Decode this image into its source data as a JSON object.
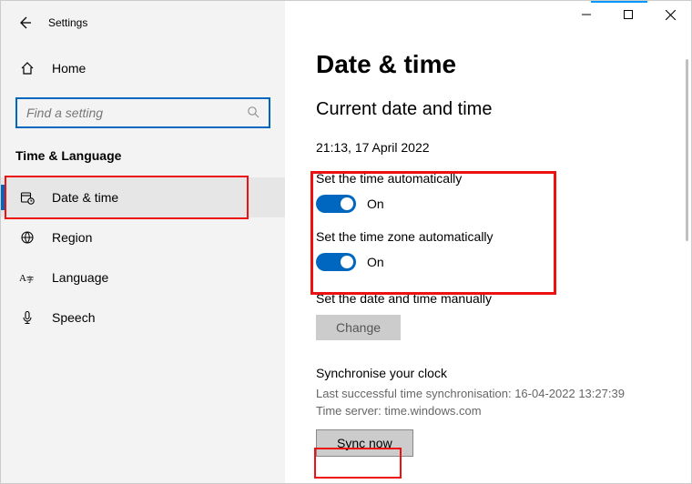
{
  "titlebar": {
    "app_name": "Settings"
  },
  "sidebar": {
    "home_label": "Home",
    "search_placeholder": "Find a setting",
    "section": "Time & Language",
    "items": [
      {
        "label": "Date & time"
      },
      {
        "label": "Region"
      },
      {
        "label": "Language"
      },
      {
        "label": "Speech"
      }
    ]
  },
  "main": {
    "title": "Date & time",
    "current_heading": "Current date and time",
    "current_value": "21:13, 17 April 2022",
    "auto_time_label": "Set the time automatically",
    "auto_time_state": "On",
    "auto_tz_label": "Set the time zone automatically",
    "auto_tz_state": "On",
    "manual_label": "Set the date and time manually",
    "change_btn": "Change",
    "sync_heading": "Synchronise your clock",
    "sync_last": "Last successful time synchronisation: 16-04-2022 13:27:39",
    "sync_server": "Time server: time.windows.com",
    "sync_btn": "Sync now"
  }
}
